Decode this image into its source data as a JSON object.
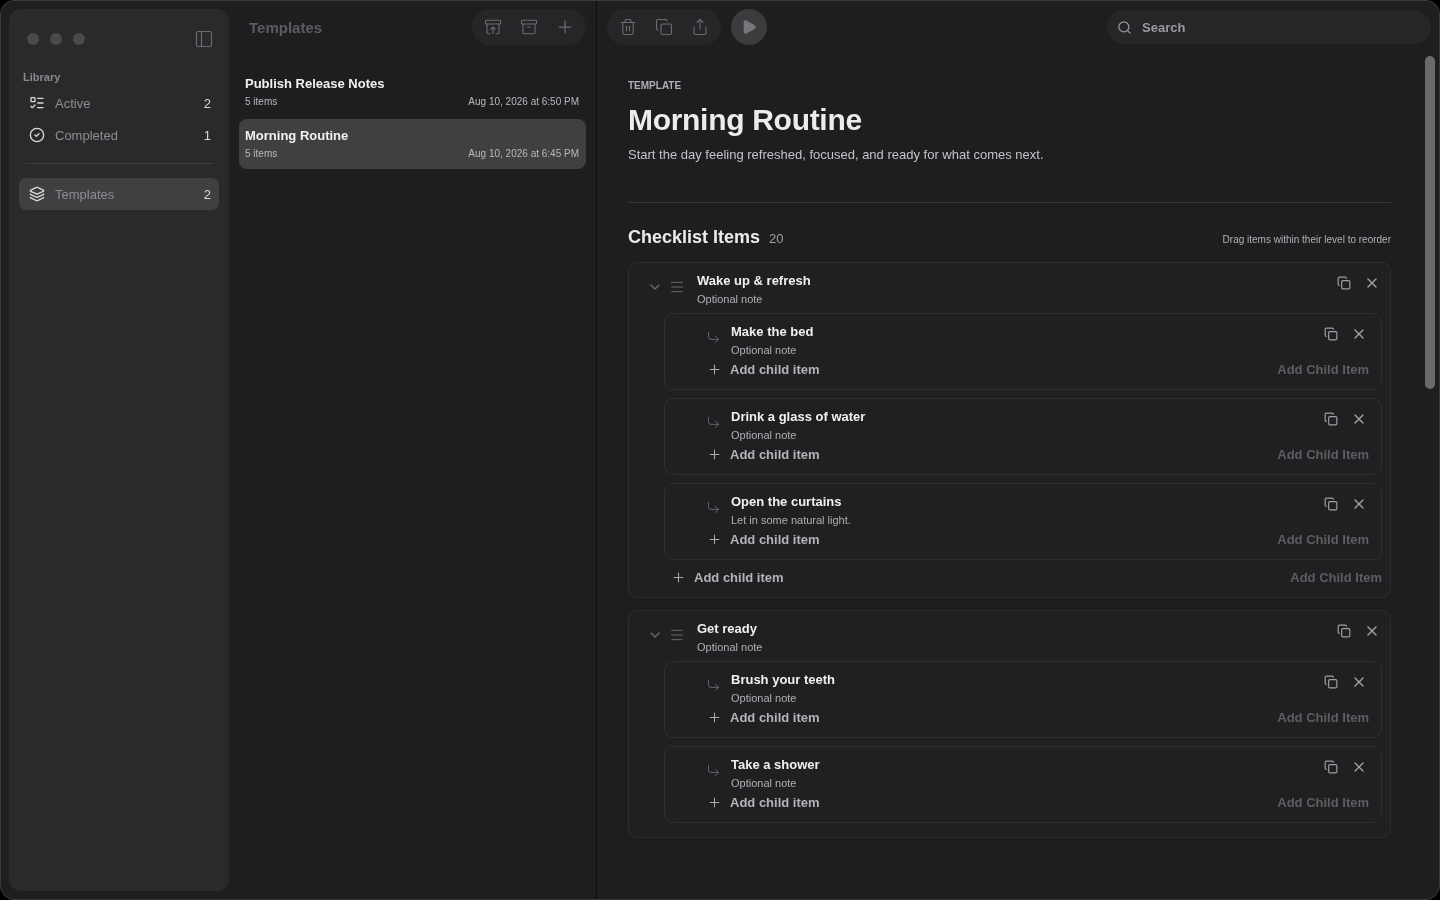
{
  "sidebar": {
    "section_label": "Library",
    "library_items": [
      {
        "label": "Active",
        "count": "2",
        "selected": false
      },
      {
        "label": "Completed",
        "count": "1",
        "selected": false
      }
    ],
    "templates_item": {
      "label": "Templates",
      "count": "2",
      "selected": true
    }
  },
  "list": {
    "title": "Templates",
    "rows": [
      {
        "title": "Publish Release Notes",
        "subtitle": "5 items",
        "date": "Aug 10, 2026 at 6:50 PM",
        "selected": false
      },
      {
        "title": "Morning Routine",
        "subtitle": "5 items",
        "date": "Aug 10, 2026 at 6:45 PM",
        "selected": true
      }
    ]
  },
  "detail": {
    "search": {
      "placeholder": "Search"
    },
    "eyebrow": "TEMPLATE",
    "title": "Morning Routine",
    "description": "Start the day feeling refreshed, focused, and ready for what comes next.",
    "checklist_title": "Checklist Items",
    "checklist_count": "20",
    "hint": "Drag items within their level to reorder",
    "items": [
      {
        "title": "Wake up & refresh",
        "note": "Optional note",
        "expanded": true,
        "add_label": "Add child item",
        "add_hint": "Add Child Item",
        "children": [
          {
            "title": "Make the bed",
            "note": "Optional note",
            "add_label": "Add child item",
            "add_hint": "Add Child Item"
          },
          {
            "title": "Drink a glass of water",
            "note": "Optional note",
            "add_label": "Add child item",
            "add_hint": "Add Child Item"
          },
          {
            "title": "Open the curtains",
            "note": "Let in some natural light.",
            "add_label": "Add child item",
            "add_hint": "Add Child Item"
          }
        ]
      },
      {
        "title": "Get ready",
        "note": "Optional note",
        "expanded": true,
        "children": [
          {
            "title": "Brush your teeth",
            "note": "Optional note",
            "add_label": "Add child item",
            "add_hint": "Add Child Item"
          },
          {
            "title": "Take a shower",
            "note": "Optional note",
            "add_label": "Add child item",
            "add_hint": "Add Child Item"
          }
        ]
      }
    ]
  }
}
